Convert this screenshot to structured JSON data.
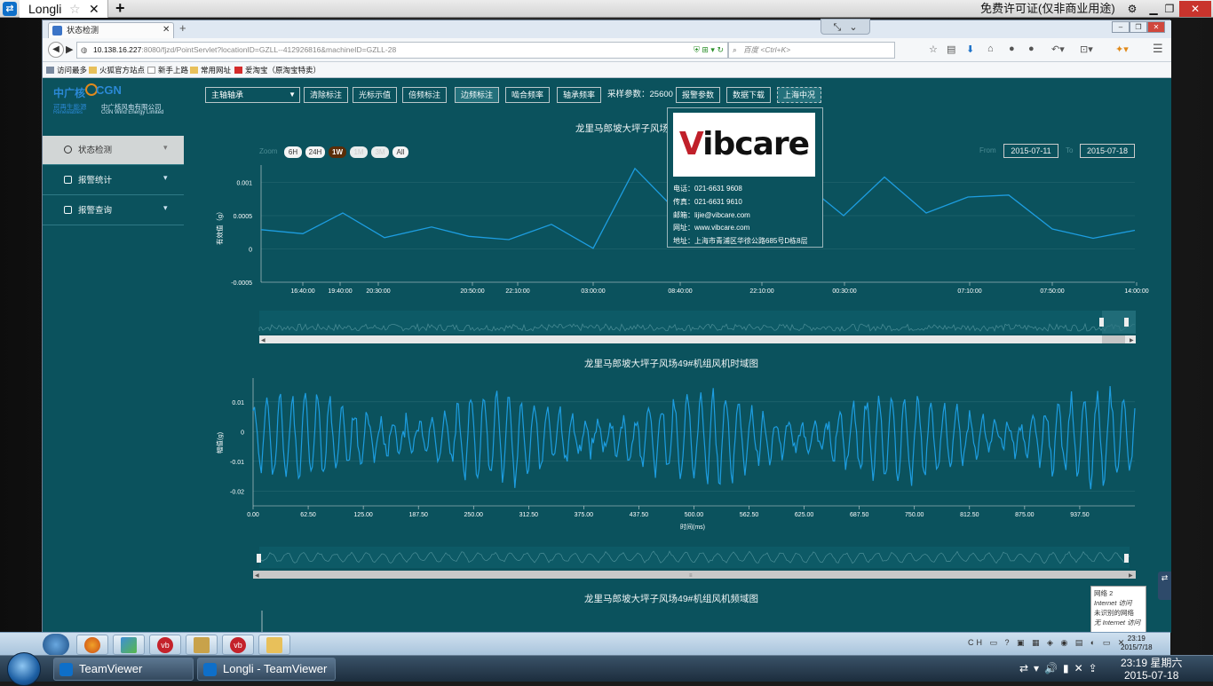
{
  "teamviewer": {
    "tab_label": "Longli",
    "license_text": "免费许可证(仅非商业用途)"
  },
  "browser": {
    "tab_title": "状态检测",
    "url_host": "10.138.16.227",
    "url_rest": ":8080/fjzd/PointServlet?locationID=GZLL--412926816&machineID=GZLL-28",
    "search_placeholder": "百度 <Ctrl+K>",
    "bookmarks": [
      "访问最多",
      "火狐官方站点",
      "新手上路",
      "常用网址",
      "爱淘宝（原淘宝特卖）"
    ]
  },
  "logo": {
    "cn": "中广核",
    "en": "CGN",
    "renew_cn": "可再生能源",
    "renew_en": "Renewables",
    "company_cn": "中广核风电有限公司",
    "company_en": "CGN Wind Energy Limited"
  },
  "sidebar": {
    "items": [
      {
        "label": "状态检测",
        "icon": "dashboard-icon",
        "active": true
      },
      {
        "label": "报警统计",
        "icon": "table-icon",
        "active": false
      },
      {
        "label": "报警查询",
        "icon": "user-icon",
        "active": false
      }
    ]
  },
  "toolbar": {
    "select_value": "主轴轴承",
    "buttons": [
      "清除标注",
      "光标示值",
      "倍频标注",
      "边频标注",
      "啮合频率",
      "轴承频率"
    ],
    "sampling_label": "采样参数：25600",
    "buttons2": [
      "报警参数",
      "数据下载",
      "上海中况"
    ]
  },
  "trend_chart": {
    "title": "龙里马郎坡大坪子风场",
    "zoom_label": "Zoom",
    "zoom_buttons": [
      "6H",
      "24H",
      "1W",
      "1M",
      "3M",
      "All"
    ],
    "zoom_selected": "1W",
    "from_label": "From",
    "from_date": "2015-07-11",
    "to_label": "To",
    "to_date": "2015-07-18",
    "ylabel": "有效值（g）",
    "yticks": [
      "0.001",
      "0.0005",
      "0",
      "-0.0005"
    ],
    "xticks": [
      "16:40:00",
      "19:40:00",
      "20:30:00",
      "20:50:00",
      "22:10:00",
      "03:00:00",
      "08:40:00",
      "22:10:00",
      "00:30:00",
      "07:10:00",
      "07:50:00",
      "14:00:00"
    ],
    "color": "#1d9de0"
  },
  "chart_data": [
    {
      "type": "line",
      "title": "龙里马郎坡大坪子风场",
      "ylabel": "有效值（g）",
      "ylim": [
        -0.0005,
        0.0011
      ],
      "categories": [
        "16:40:00",
        "19:40:00",
        "20:30:00",
        "20:50:00",
        "22:10:00",
        "03:00:00",
        "08:40:00",
        "22:10:00",
        "00:30:00",
        "07:10:00",
        "07:50:00",
        "14:00:00"
      ],
      "x": [
        0,
        1,
        2,
        3,
        4,
        5,
        6,
        7,
        8,
        9,
        10,
        11,
        12,
        13,
        14,
        15,
        16,
        17,
        18,
        19,
        20,
        21
      ],
      "values": [
        0.00029,
        0.00023,
        0.00054,
        0.00017,
        0.00033,
        0.00019,
        0.00014,
        0.00037,
        1e-05,
        0.00121,
        0.00058,
        0.00062,
        0.00085,
        0.00099,
        0.0005,
        0.00108,
        0.00054,
        0.00078,
        0.00081,
        0.0003,
        0.00016,
        0.00028
      ]
    },
    {
      "type": "line",
      "title": "龙里马郎坡大坪子风场49#机组风机时域图",
      "xlabel": "时间(ms)",
      "ylabel": "幅值(g)",
      "xlim": [
        0,
        1000
      ],
      "ylim": [
        -0.02,
        0.015
      ],
      "xticks": [
        "0.00",
        "62.50",
        "125.00",
        "187.50",
        "250.00",
        "312.50",
        "375.00",
        "437.50",
        "500.00",
        "562.50",
        "625.00",
        "687.50",
        "750.00",
        "812.50",
        "875.00",
        "937.50"
      ],
      "yticks": [
        "0.01",
        "0",
        "-0.01",
        "-0.02"
      ]
    }
  ],
  "time_chart": {
    "title": "龙里马郎坡大坪子风场49#机组风机时域图",
    "xlabel": "时间(ms)",
    "ylabel": "幅值(g)"
  },
  "freq_chart": {
    "title": "龙里马郎坡大坪子风场49#机组风机频域图"
  },
  "contact_popup": {
    "brand_v": "V",
    "brand_rest": "ibcare",
    "phone": "电话：021-6631 9608",
    "fax": "传真：021-6631 9610",
    "email": "邮箱：lijie@vibcare.com",
    "web": "网址：www.vibcare.com",
    "address": "地址：上海市青浦区华徐公路685号D栋8层"
  },
  "network_popup": {
    "line1": "网络  2",
    "line2": "Internet 访问",
    "line3": "未识别的网络",
    "line4": "无 Internet 访问"
  },
  "remote_taskbar": {
    "time": "23:19",
    "date": "2015/7/18"
  },
  "local_taskbar": {
    "items": [
      "TeamViewer",
      "Longli - TeamViewer"
    ],
    "time": "23:19 星期六",
    "date": "2015-07-18"
  }
}
